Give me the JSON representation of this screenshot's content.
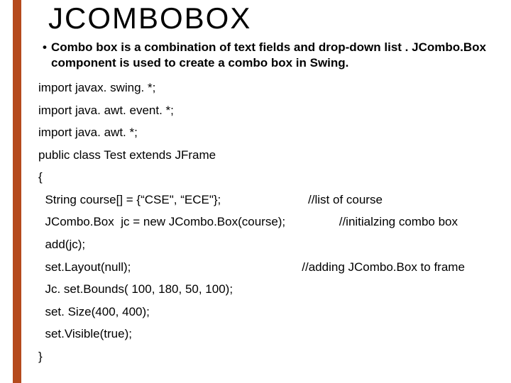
{
  "title": "JCOMBOBOX",
  "bullet": "Combo box is a combination of text fields and drop-down list . JCombo.Box component is used to create a combo box in Swing.",
  "code": [
    "import javax. swing. *;",
    "import java. awt. event. *;",
    "import java. awt. *;",
    "public class Test extends JFrame",
    "{",
    "  String course[] = {“CSE\", “ECE\"};                          //list of course",
    "  JCombo.Box  jc = new JCombo.Box(course);                //initialzing combo box",
    "  add(jc);",
    "  set.Layout(null);                                                   //adding JCombo.Box to frame",
    "  Jc. set.Bounds( 100, 180, 50, 100);",
    "  set. Size(400, 400);",
    "  set.Visible(true);",
    "}"
  ]
}
